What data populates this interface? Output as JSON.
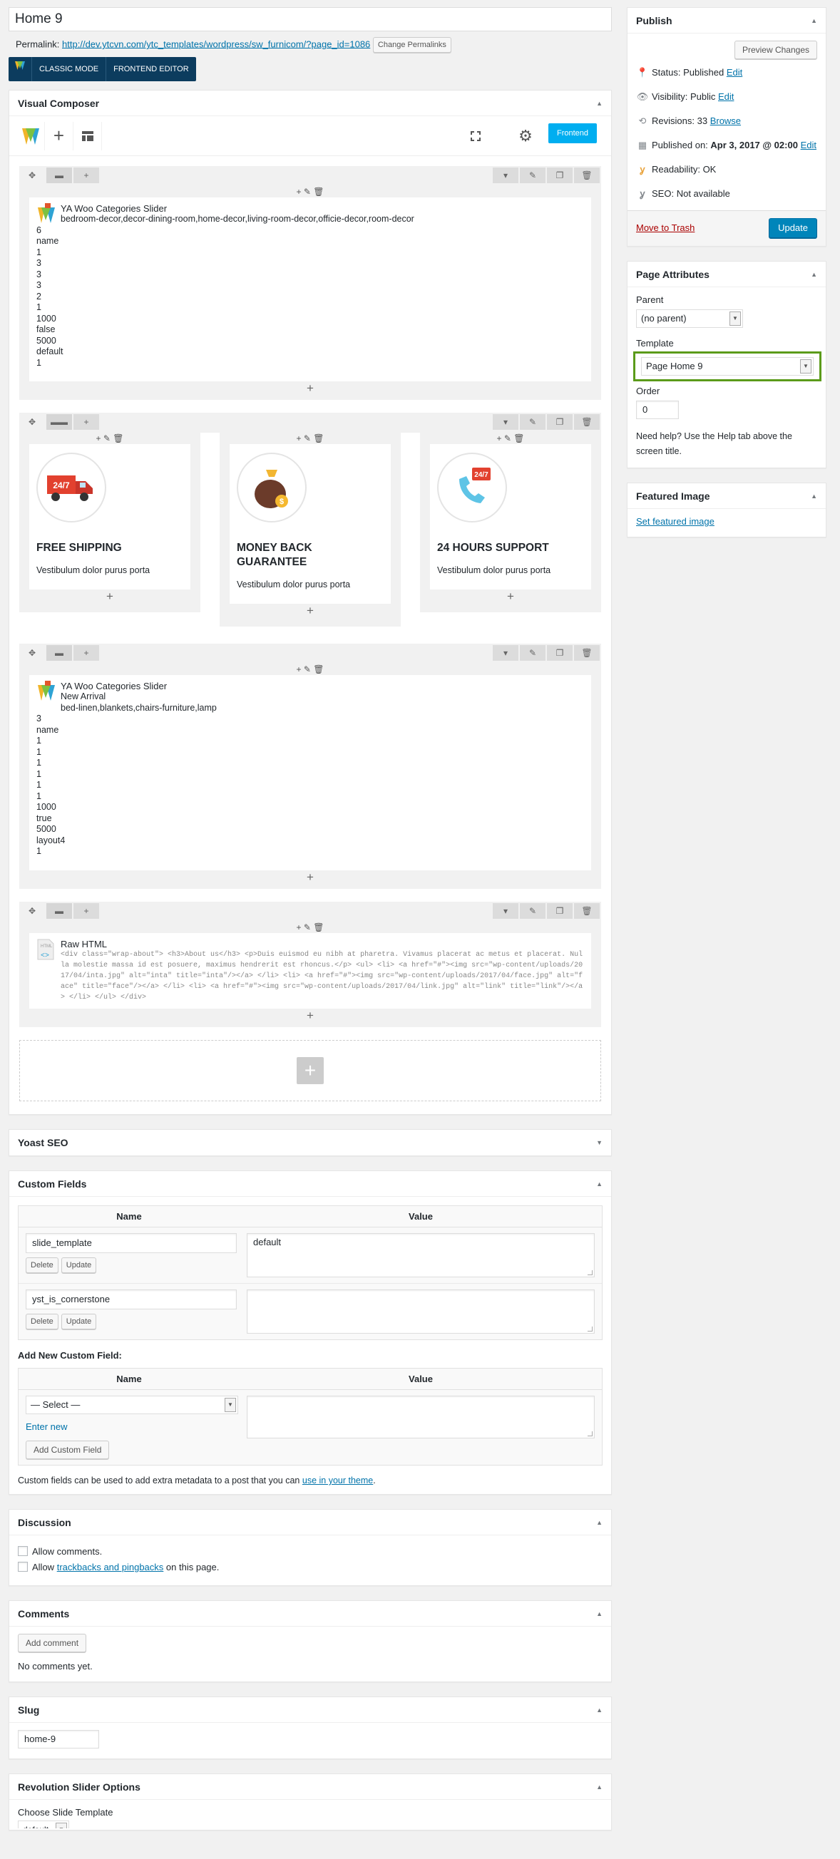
{
  "page": {
    "title": "Home 9",
    "permalink_label": "Permalink:",
    "permalink_url": "http://dev.ytcvn.com/ytc_templates/wordpress/sw_furnicom/?page_id=1086",
    "change_permalinks": "Change Permalinks",
    "mode_classic": "CLASSIC MODE",
    "mode_frontend": "FRONTEND EDITOR"
  },
  "vc": {
    "title": "Visual Composer",
    "frontend_btn": "Frontend",
    "slider1": {
      "title": "YA Woo Categories Slider",
      "subtitle": "bedroom-decor,decor-dining-room,home-decor,living-room-decor,officie-decor,room-decor",
      "params": [
        "6",
        "name",
        "1",
        "3",
        "3",
        "3",
        "2",
        "1",
        "1000",
        "false",
        "5000",
        "default",
        "1"
      ]
    },
    "features": [
      {
        "title": "FREE SHIPPING",
        "text": "Vestibulum dolor purus porta",
        "icon_label": "24/7"
      },
      {
        "title": "MONEY BACK GUARANTEE",
        "text": "Vestibulum dolor purus porta",
        "icon_label": "$"
      },
      {
        "title": "24 HOURS SUPPORT",
        "text": "Vestibulum dolor purus porta",
        "icon_label": "24/7"
      }
    ],
    "slider2": {
      "title": "YA Woo Categories Slider",
      "subtitle1": "New Arrival",
      "subtitle2": "bed-linen,blankets,chairs-furniture,lamp",
      "params": [
        "3",
        "name",
        "1",
        "1",
        "1",
        "1",
        "1",
        "1",
        "1000",
        "true",
        "5000",
        "layout4",
        "1"
      ]
    },
    "raw": {
      "title": "Raw HTML",
      "code": "<div class=\"wrap-about\"> <h3>About us</h3> <p>Duis euismod eu nibh at pharetra. Vivamus placerat ac metus et placerat. Nulla molestie massa id est posuere, maximus hendrerit est rhoncus.</p> <ul> <li> <a href=\"#\"><img src=\"wp-content/uploads/2017/04/inta.jpg\" alt=\"inta\" title=\"inta\"/></a> </li> <li> <a href=\"#\"><img src=\"wp-content/uploads/2017/04/face.jpg\" alt=\"face\" title=\"face\"/></a> </li> <li> <a href=\"#\"><img src=\"wp-content/uploads/2017/04/link.jpg\" alt=\"link\" title=\"link\"/></a> </li> </ul> </div>"
    }
  },
  "yoast": {
    "title": "Yoast SEO"
  },
  "custom_fields": {
    "title": "Custom Fields",
    "col_name": "Name",
    "col_value": "Value",
    "rows": [
      {
        "name": "slide_template",
        "value": "default"
      },
      {
        "name": "yst_is_cornerstone",
        "value": ""
      }
    ],
    "delete": "Delete",
    "update": "Update",
    "add_new_label": "Add New Custom Field:",
    "select_default": "— Select —",
    "enter_new": "Enter new",
    "add_btn": "Add Custom Field",
    "note_prefix": "Custom fields can be used to add extra metadata to a post that you can",
    "note_link": "use in your theme",
    "note_suffix": "."
  },
  "discussion": {
    "title": "Discussion",
    "allow_comments": "Allow comments.",
    "allow_prefix": "Allow",
    "allow_link": "trackbacks and pingbacks",
    "allow_suffix": "on this page."
  },
  "comments": {
    "title": "Comments",
    "add_btn": "Add comment",
    "none": "No comments yet."
  },
  "slug": {
    "title": "Slug",
    "value": "home-9"
  },
  "revslider": {
    "title": "Revolution Slider Options",
    "choose": "Choose Slide Template",
    "value": "default"
  },
  "publish": {
    "title": "Publish",
    "preview": "Preview Changes",
    "status_label": "Status:",
    "status_value": "Published",
    "edit": "Edit",
    "visibility_label": "Visibility:",
    "visibility_value": "Public",
    "revisions_label": "Revisions:",
    "revisions_value": "33",
    "browse": "Browse",
    "published_label": "Published on:",
    "published_value": "Apr 3, 2017 @ 02:00",
    "readability_label": "Readability:",
    "readability_value": "OK",
    "seo_label": "SEO:",
    "seo_value": "Not available",
    "trash": "Move to Trash",
    "update": "Update"
  },
  "page_attributes": {
    "title": "Page Attributes",
    "parent_label": "Parent",
    "parent_value": "(no parent)",
    "template_label": "Template",
    "template_value": "Page Home 9",
    "order_label": "Order",
    "order_value": "0",
    "help": "Need help? Use the Help tab above the screen title."
  },
  "featured": {
    "title": "Featured Image",
    "link": "Set featured image"
  },
  "colors": {
    "accent": "#0073aa",
    "vc_blue": "#00aef0",
    "highlight": "#5b9b1a",
    "trash": "#a00"
  }
}
